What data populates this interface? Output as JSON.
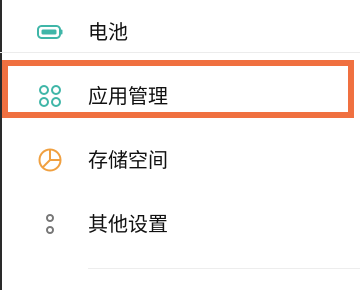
{
  "settings_list": {
    "items": [
      {
        "label": "电池",
        "icon": "battery-icon",
        "icon_color": "#3fb6a8"
      },
      {
        "label": "应用管理",
        "icon": "apps-grid-icon",
        "icon_color": "#3fb6a8"
      },
      {
        "label": "存储空间",
        "icon": "storage-pie-icon",
        "icon_color": "#f0a040"
      },
      {
        "label": "其他设置",
        "icon": "more-dots-icon",
        "icon_color": "#777777"
      }
    ]
  },
  "highlight": {
    "target": "应用管理",
    "color": "#f07040"
  }
}
